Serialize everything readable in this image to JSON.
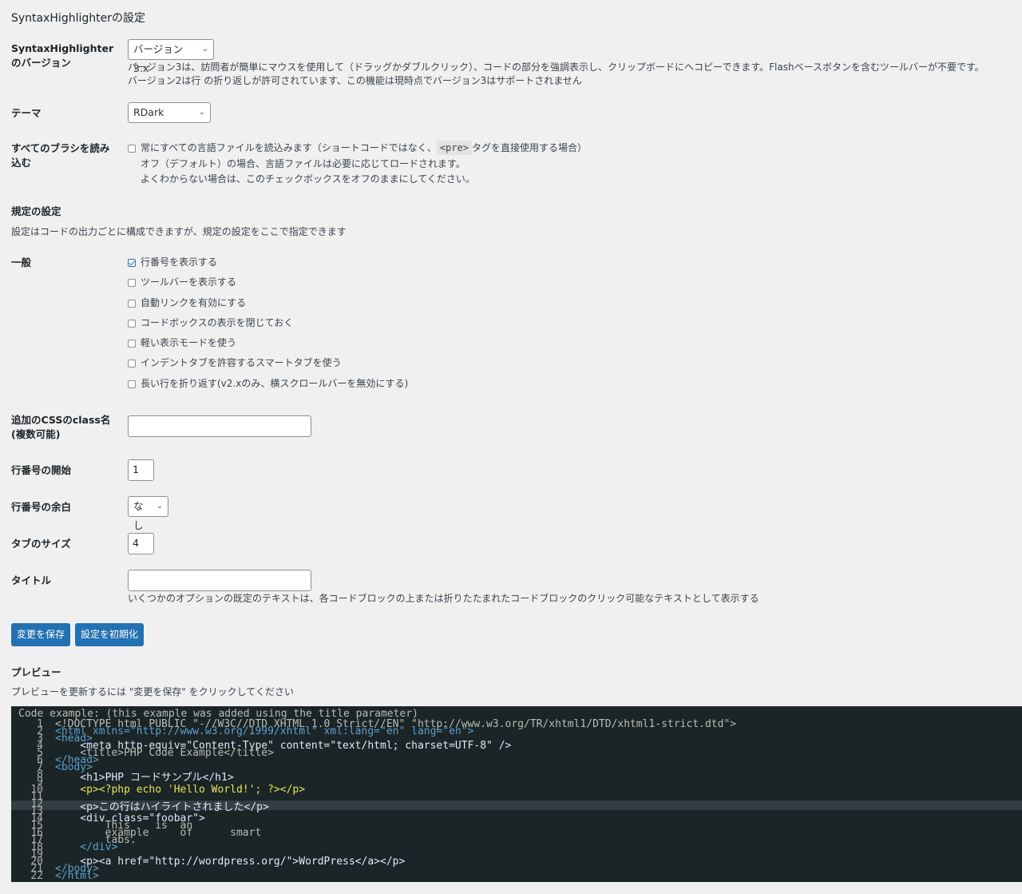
{
  "page_title": "SyntaxHighlighterの設定",
  "version": {
    "label": "SyntaxHighlighterのバージョン",
    "selected": "バージョン 3.x",
    "desc_line1": "バージョン3は、訪問者が簡単にマウスを使用して（ドラッグかダブルクリック）、コードの部分を強調表示し、クリップボードにヘコピーできます。Flashベースボタンを含むツールバーが不要です。",
    "desc_line2": "バージョン2は行 の折り返しが許可されています、この機能は現時点でバージョン3はサポートされません"
  },
  "theme": {
    "label": "テーマ",
    "selected": "RDark"
  },
  "load_all": {
    "label": "すべてのブラシを読み込む",
    "checkbox_before": "常にすべての言語ファイルを読込みます（ショートコードではなく、",
    "tag": "<pre>",
    "checkbox_after": "タグを直接使用する場合）",
    "desc1": "オフ（デフォルト）の場合、言語ファイルは必要に応じてロードされます。",
    "desc2": "よくわからない場合は、このチェックボックスをオフのままにしてください。"
  },
  "defaults": {
    "heading": "規定の設定",
    "desc": "設定はコードの出力ごとに構成できますが、規定の設定をここで指定できます"
  },
  "general": {
    "label": "一般",
    "options": [
      {
        "label": "行番号を表示する",
        "checked": true
      },
      {
        "label": "ツールバーを表示する",
        "checked": false
      },
      {
        "label": "自動リンクを有効にする",
        "checked": false
      },
      {
        "label": "コードボックスの表示を閉じておく",
        "checked": false
      },
      {
        "label": "軽い表示モードを使う",
        "checked": false
      },
      {
        "label": "インデントタブを許容するスマートタブを使う",
        "checked": false
      },
      {
        "label": "長い行を折り返す(v2.xのみ、横スクロールバーを無効にする)",
        "checked": false
      }
    ]
  },
  "css_class": {
    "label_line1": "追加のCSSのclass名",
    "label_line2": "(複数可能)",
    "value": ""
  },
  "line_start": {
    "label": "行番号の開始",
    "value": "1"
  },
  "line_padding": {
    "label": "行番号の余白",
    "selected": "なし"
  },
  "tab_size": {
    "label": "タブのサイズ",
    "value": "4"
  },
  "title_field": {
    "label": "タイトル",
    "value": "",
    "desc": "いくつかのオプションの既定のテキストは、各コードブロックの上または折りたたまれたコードブロックのクリック可能なテキストとして表示する"
  },
  "buttons": {
    "save": "変更を保存",
    "reset": "設定を初期化"
  },
  "preview": {
    "heading": "プレビュー",
    "desc": "プレビューを更新するには \"変更を保存\" をクリックしてください",
    "code_title": "Code example: (this example was added using the title parameter)",
    "line_numbers": [
      "1",
      "2",
      "3",
      "4",
      "5",
      "6",
      "7",
      "8",
      "9",
      "10",
      "11",
      "12",
      "13",
      "14",
      "15",
      "16",
      "17",
      "18",
      "19",
      "20",
      "21",
      "22"
    ],
    "lines": [
      "<!DOCTYPE html PUBLIC \"-//W3C//DTD XHTML 1.0 Strict//EN\" \"http://www.w3.org/TR/xhtml1/DTD/xhtml1-strict.dtd\">",
      "<html xmlns=\"http://www.w3.org/1999/xhtml\" xml:lang=\"en\" lang=\"en\">",
      "<head>",
      "    <meta http-equiv=\"Content-Type\" content=\"text/html; charset=UTF-8\" />",
      "    <title>PHP Code Example</title>",
      "</head>",
      "<body>",
      "    <h1>PHP コードサンプル</h1>",
      "",
      "    <p><?php echo 'Hello World!'; ?></p>",
      "",
      "    <p>この行はハイライトされました</p>",
      "",
      "    <div class=\"foobar\">",
      "        This    is  an",
      "        example     of      smart",
      "        tabs.",
      "    </div>",
      "",
      "    <p><a href=\"http://wordpress.org/\">WordPress</a></p>",
      "</body>",
      "</html>"
    ]
  }
}
